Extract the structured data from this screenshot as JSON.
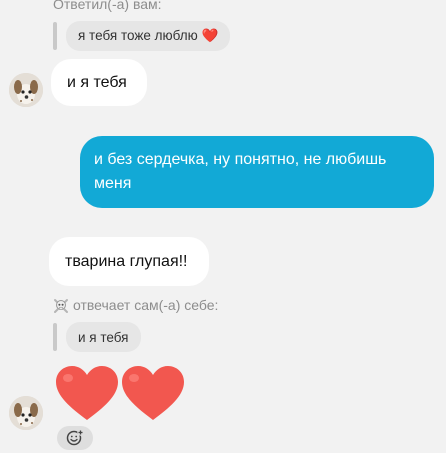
{
  "messages": {
    "reply_to_you": {
      "header": "Ответил(-а) вам:",
      "quoted_text": "я тебя тоже люблю ❤️"
    },
    "incoming_1": {
      "text": "и я тебя"
    },
    "outgoing_1": {
      "text": "и без сердечка, ну понятно, не любишь меня"
    },
    "incoming_2": {
      "text": "тварина глупая!!"
    },
    "self_reply": {
      "header": "отвечает сам(-а) себе:",
      "quoted_text": "и я тебя"
    },
    "incoming_3": {
      "emoji": "❤️❤️"
    }
  },
  "colors": {
    "background": "#f2f2f2",
    "outgoing_bubble": "#12a9d6",
    "incoming_bubble": "#ffffff",
    "quote_bubble": "#e6e6e6",
    "heart": "#f2574f"
  },
  "icons": {
    "skull": "skull-icon",
    "reaction": "add-reaction-icon"
  }
}
